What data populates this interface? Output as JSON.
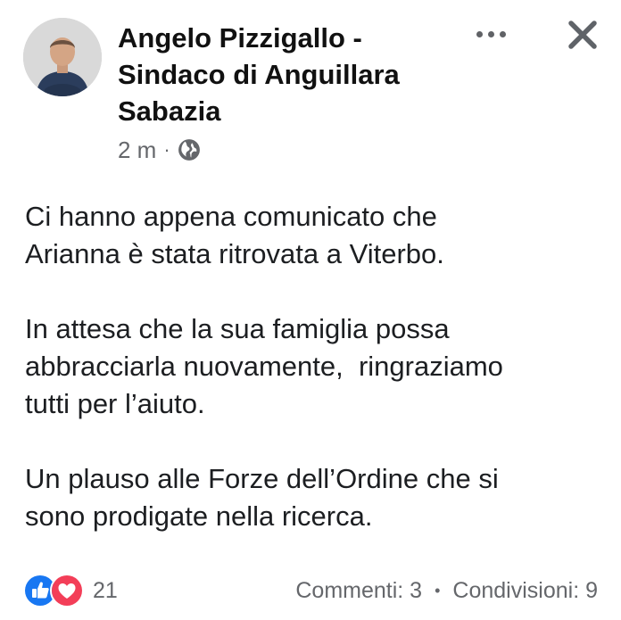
{
  "post": {
    "author": "Angelo Pizzigallo - Sindaco di Anguillara Sabazia",
    "time": "2 m",
    "meta_separator": "·",
    "paragraphs": [
      "Ci hanno appena comunicato che\nArianna è stata ritrovata a Viterbo.",
      "In attesa che la sua famiglia possa\nabbracciarla nuovamente,  ringraziamo\ntutti per l’aiuto.",
      "Un plauso alle Forze dell’Ordine che si\nsono prodigate nella ricerca."
    ]
  },
  "footer": {
    "reaction_count": "21",
    "comments": "Commenti: 3",
    "separator": "•",
    "shares": "Condivisioni: 9"
  },
  "icons": {
    "privacy": "globe-icon",
    "more": "more-options-icon",
    "close": "close-icon",
    "reactions": [
      "like-icon",
      "love-icon"
    ]
  },
  "colors": {
    "like_blue": "#1877f2",
    "love_red": "#f33e58",
    "meta_gray": "#65676b",
    "close_gray": "#5f6368"
  }
}
